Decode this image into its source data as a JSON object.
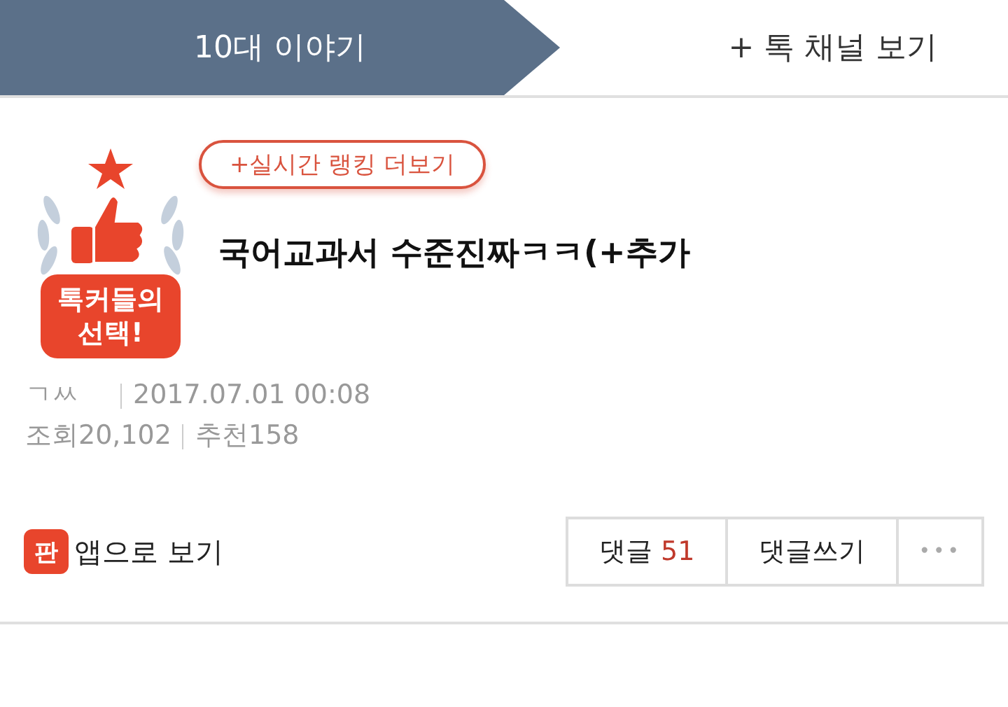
{
  "tabs": [
    {
      "label": "10대 이야기",
      "selected": true
    },
    {
      "label": "+ 톡 채널 보기",
      "selected": false
    }
  ],
  "post": {
    "badge_text": [
      "톡커들의",
      "선택!"
    ],
    "ranking_button": "+실시간 랭킹 더보기",
    "title": "국어교과서 수준진짜ㅋㅋ(+추가",
    "author": "ㄱㅆ",
    "date": "2017.07.01 00:08",
    "views": "조회20,102",
    "likes": "추천158"
  },
  "footer": {
    "app_logo": "판",
    "app_link": "앱으로 보기",
    "comments_label": "댓글",
    "comments_count": "51",
    "write_comment": "댓글쓰기",
    "more": "•••"
  }
}
